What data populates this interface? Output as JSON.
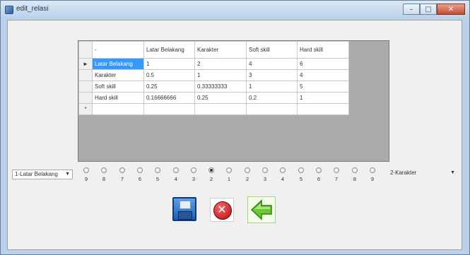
{
  "window": {
    "title": "edit_relasi"
  },
  "grid": {
    "columns": [
      "-",
      "Latar Belakang",
      "Karakter",
      "Soft skill",
      "Hard skill"
    ],
    "current_row_marker": "►",
    "new_row_marker": "*",
    "rows": [
      [
        "Latar Belakang",
        "1",
        "2",
        "4",
        "6"
      ],
      [
        "Karakter",
        "0.5",
        "1",
        "3",
        "4"
      ],
      [
        "Soft skill",
        "0.25",
        "0.33333333",
        "1",
        "5"
      ],
      [
        "Hard skill",
        "0.16666666",
        "0.25",
        "0.2",
        "1"
      ]
    ]
  },
  "left_combo": {
    "value": "1-Latar Belakang"
  },
  "right_combo": {
    "value": "2-Karakter"
  },
  "scale": {
    "labels": [
      "9",
      "8",
      "7",
      "6",
      "5",
      "4",
      "3",
      "2",
      "1",
      "2",
      "3",
      "4",
      "5",
      "6",
      "7",
      "8",
      "9"
    ],
    "selected_index": 7
  },
  "colors": {
    "selection": "#3399ff",
    "grid_background": "#ababab"
  },
  "buttons": {
    "save": {
      "icon": "save-icon"
    },
    "cancel": {
      "icon": "cancel-icon"
    },
    "back": {
      "icon": "back-arrow-icon"
    }
  }
}
